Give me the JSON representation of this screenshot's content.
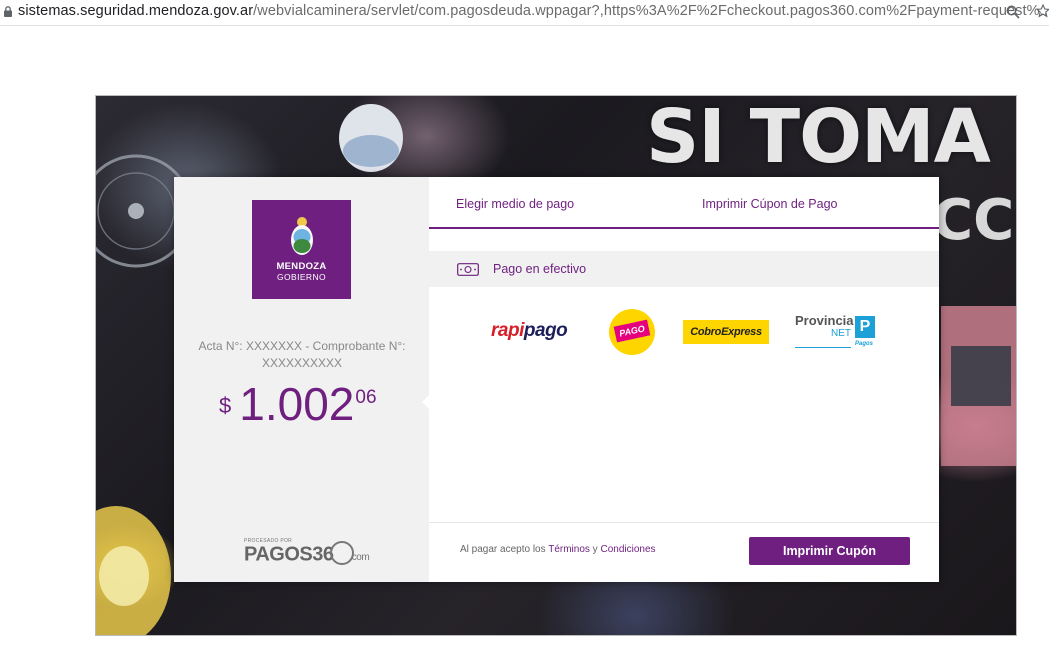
{
  "browser": {
    "url_host": "sistemas.seguridad.mendoza.gov.ar",
    "url_path": "/webvialcaminera/servlet/com.pagosdeuda.wppagar?,https%3A%2F%2Fcheckout.pagos360.com%2Fpayment-request%..."
  },
  "banner": {
    "headline": "SI TOMA",
    "subtext": "CCI"
  },
  "sidebar": {
    "logo_line1": "MENDOZA",
    "logo_line2": "GOBIERNO",
    "acta_text": "Acta N°: XXXXXXX - Comprobante N°: XXXXXXXXXX",
    "amount": {
      "currency": "$",
      "integer": "1.002",
      "cents": "06"
    },
    "processed_label": "PROCESADO POR",
    "processor_name": "PAGOS36",
    "processor_suffix": ".com"
  },
  "tabs": [
    {
      "label": "Elegir medio de pago"
    },
    {
      "label": "Imprimir Cúpon de Pago"
    }
  ],
  "method": {
    "label": "Pago en efectivo"
  },
  "providers": {
    "rapipago_a": "rapi",
    "rapipago_b": "pago",
    "pagofacil": "PAGO",
    "cobroexpress": "CobroExpress",
    "provincia": "Provincia",
    "provincia_net": "NET",
    "provincia_pagos": "Pagos"
  },
  "footer": {
    "terms_prefix": "Al pagar acepto los ",
    "terms_link1": "Términos",
    "terms_y": " y ",
    "terms_link2": "Condiciones",
    "print_button": "Imprimir Cupón"
  },
  "colors": {
    "brand": "#6e1f7f"
  }
}
